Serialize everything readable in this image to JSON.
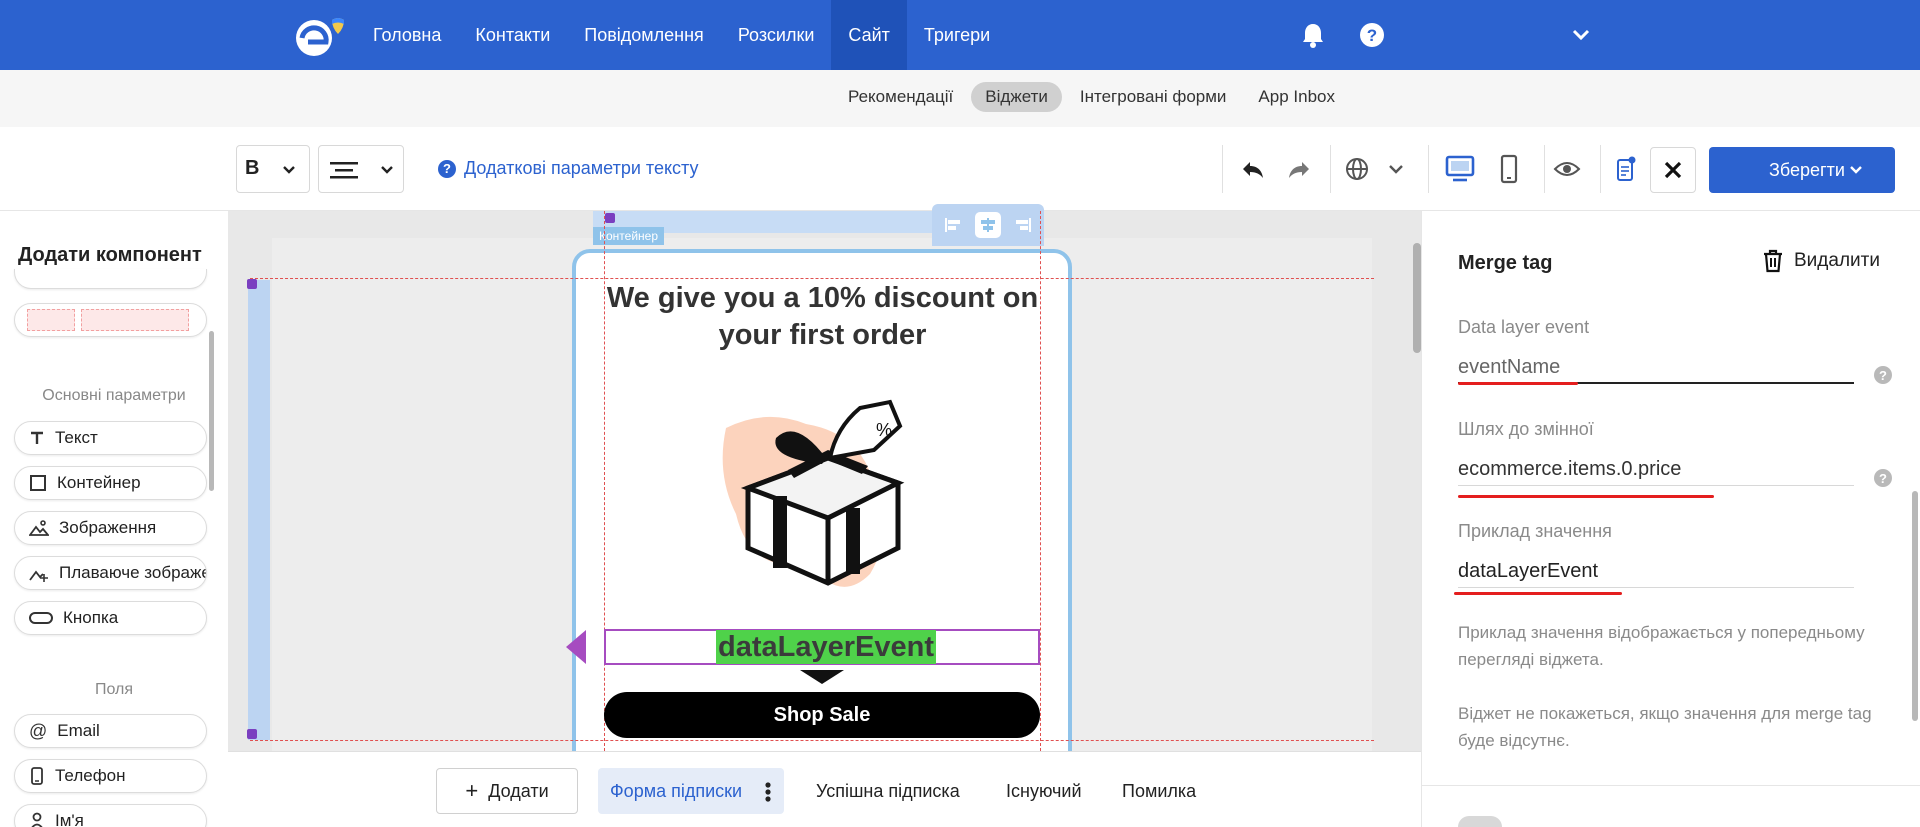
{
  "nav": {
    "items": [
      "Головна",
      "Контакти",
      "Повідомлення",
      "Розсилки",
      "Сайт",
      "Тригери"
    ],
    "active_index": 4
  },
  "subnav": {
    "items": [
      "Рекомендації",
      "Віджети",
      "Інтегровані форми",
      "App Inbox"
    ],
    "active_index": 1
  },
  "toolbar": {
    "font_weight": "B",
    "text_options_label": "Додаткові параметри тексту",
    "save_label": "Зберегти"
  },
  "left": {
    "title": "Додати компонент",
    "section_basic": "Основні параметри",
    "basic_items": [
      "Текст",
      "Контейнер",
      "Зображення",
      "Плаваюче зображення",
      "Кнопка"
    ],
    "section_fields": "Поля",
    "field_items": [
      "Email",
      "Телефон",
      "Ім'я"
    ]
  },
  "canvas": {
    "container_label": "Контейнер",
    "title_line1": "We give you a 10% discount on",
    "title_line2": "your first order",
    "merge_value": "dataLayerEvent",
    "button_label": "Shop Sale"
  },
  "bottom": {
    "add_label": "Додати",
    "tabs": [
      "Форма підписки",
      "Успішна підписка",
      "Існуючий",
      "Помилка"
    ],
    "active_index": 0
  },
  "panel": {
    "title": "Merge tag",
    "delete_label": "Видалити",
    "event_label": "Data layer event",
    "event_value": "eventName",
    "path_label": "Шлях до змінної",
    "path_value": "ecommerce.items.0.price",
    "example_label": "Приклад значення",
    "example_value": "dataLayerEvent",
    "note1": "Приклад значення відображається у попередньому перегляді віджета.",
    "note2": "Віджет не покажеться, якщо значення для merge tag буде відсутнє."
  },
  "colors": {
    "brand": "#2c62cf",
    "highlight": "#4fd24a",
    "annotation": "#e41e1e"
  }
}
